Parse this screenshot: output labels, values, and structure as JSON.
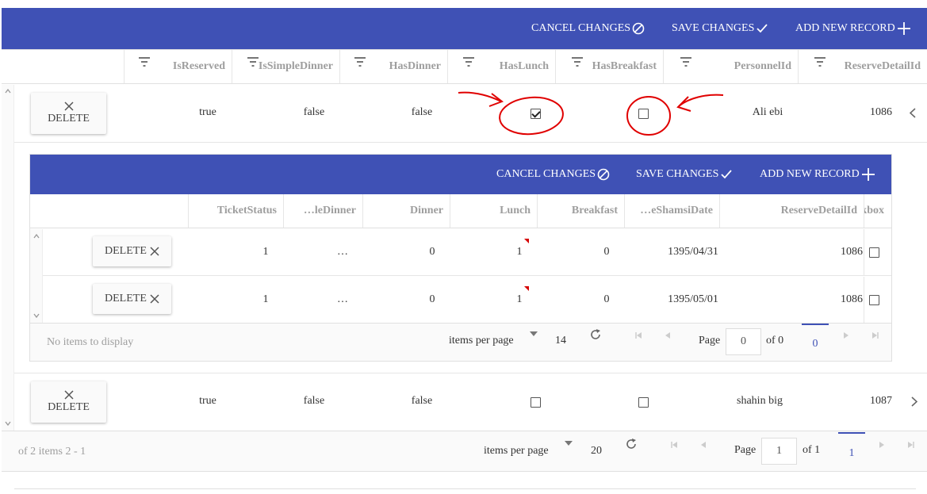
{
  "outer": {
    "toolbar": {
      "cancel_label": "CANCEL CHANGES",
      "save_label": "SAVE CHANGES",
      "add_label": "ADD NEW RECORD"
    },
    "columns": [
      "IsReserved",
      "IsSimpleDinner",
      "HasDinner",
      "HasLunch",
      "HasBreakfast",
      "PersonnelId",
      "ReserveDetailId"
    ],
    "rows": [
      {
        "delete_label": "DELETE",
        "IsReserved": "true",
        "IsSimpleDinner": "false",
        "HasDinner": "false",
        "HasLunch": true,
        "HasBreakfast": false,
        "PersonnelId": "Ali ebi",
        "ReserveDetailId": "1086",
        "expanded": true
      },
      {
        "delete_label": "DELETE",
        "IsReserved": "true",
        "IsSimpleDinner": "false",
        "HasDinner": "false",
        "HasLunch": false,
        "HasBreakfast": false,
        "PersonnelId": "shahin big",
        "ReserveDetailId": "1087",
        "expanded": false
      }
    ],
    "pager": {
      "status": "of 2 items 2 - 1",
      "items_per_page_label": "items per page",
      "page_size": "20",
      "page_label": "Page",
      "page_value": "1",
      "of_label": "of 1",
      "current_page": "1"
    }
  },
  "nested": {
    "toolbar": {
      "cancel_label": "CANCEL CHANGES",
      "save_label": "SAVE CHANGES",
      "add_label": "ADD NEW RECORD"
    },
    "columns": [
      "TicketStatus",
      "…leDinner",
      "Dinner",
      "Lunch",
      "Breakfast",
      "…eShamsiDate",
      "ReserveDetailId",
      "…kbox"
    ],
    "rows": [
      {
        "delete_label": "DELETE",
        "TicketStatus": "1",
        "SimpleDinner": "…",
        "Dinner": "0",
        "Lunch": "1",
        "Breakfast": "0",
        "ShamsiDate": "1395/04/31",
        "ReserveDetailId": "1086",
        "Checkbox": false
      },
      {
        "delete_label": "DELETE",
        "TicketStatus": "1",
        "SimpleDinner": "…",
        "Dinner": "0",
        "Lunch": "1",
        "Breakfast": "0",
        "ShamsiDate": "1395/05/01",
        "ReserveDetailId": "1086",
        "Checkbox": false
      }
    ],
    "pager": {
      "status": "No items to display",
      "items_per_page_label": "items per page",
      "page_size": "14",
      "page_label": "Page",
      "page_value": "0",
      "of_label": "of 0",
      "current_page": "0"
    }
  },
  "colors": {
    "toolbar": "#3f51b5",
    "annotation": "#e00000",
    "dirty_marker": "#d50000"
  }
}
